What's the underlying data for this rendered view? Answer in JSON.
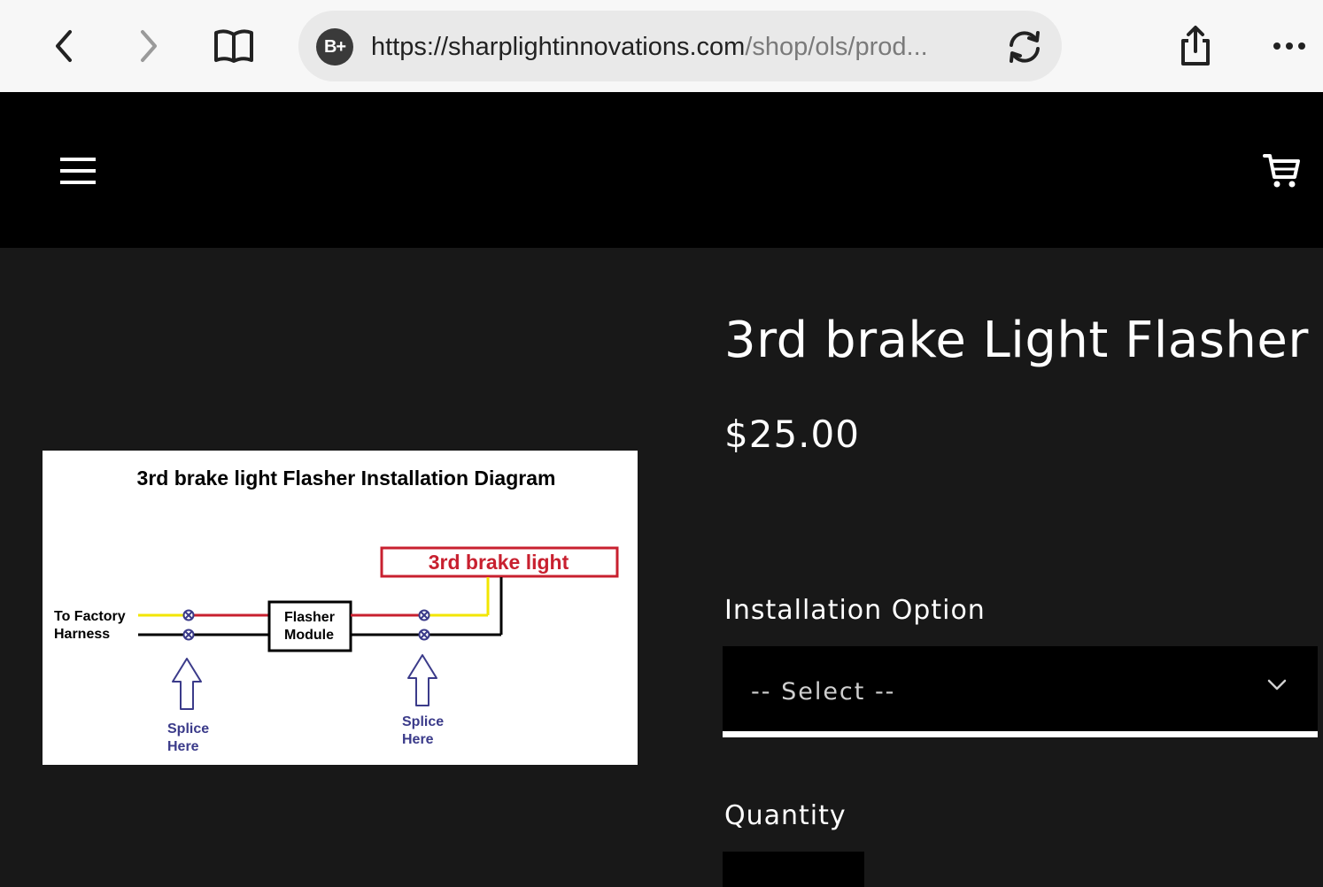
{
  "browser": {
    "url_domain": "https://sharplightinnovations.com",
    "url_path": "/shop/ols/prod...",
    "site_badge": "B+"
  },
  "product": {
    "title": "3rd brake Light Flasher",
    "price": "$25.00",
    "installation_label": "Installation Option",
    "installation_selected": "-- Select --",
    "quantity_label": "Quantity"
  },
  "diagram": {
    "title": "3rd brake light Flasher Installation Diagram",
    "brake_light_label": "3rd brake light",
    "harness_line1": "To Factory",
    "harness_line2": "Harness",
    "module_line1": "Flasher",
    "module_line2": "Module",
    "splice_line1": "Splice",
    "splice_line2": "Here",
    "colors": {
      "yellow": "#f2e600",
      "red": "#c8202f",
      "black": "#000000",
      "arrow": "#3b3b8a"
    }
  }
}
